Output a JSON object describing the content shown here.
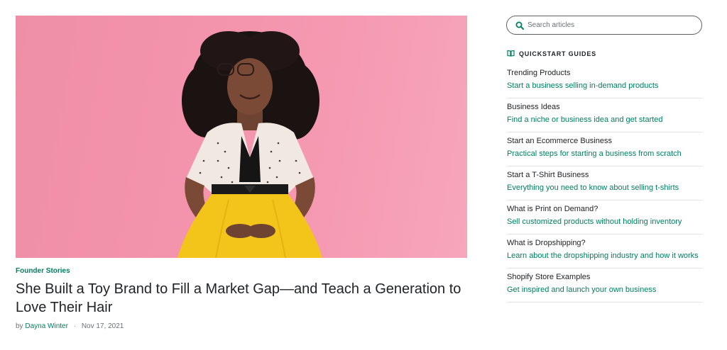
{
  "article": {
    "category": "Founder Stories",
    "title": "She Built a Toy Brand to Fill a Market Gap—and Teach a Generation to Love Their Hair",
    "byline_prefix": "by",
    "author": "Dayna Winter",
    "separator": "·",
    "date": "Nov 17, 2021"
  },
  "search": {
    "placeholder": "Search articles",
    "icon": "search-icon"
  },
  "guides": {
    "heading": "QUICKSTART GUIDES",
    "icon": "book-icon",
    "items": [
      {
        "title": "Trending Products",
        "desc": "Start a business selling in-demand products"
      },
      {
        "title": "Business Ideas",
        "desc": "Find a niche or business idea and get started"
      },
      {
        "title": "Start an Ecommerce Business",
        "desc": "Practical steps for starting a business from scratch"
      },
      {
        "title": "Start a T-Shirt Business",
        "desc": "Everything you need to know about selling t-shirts"
      },
      {
        "title": "What is Print on Demand?",
        "desc": "Sell customized products without holding inventory"
      },
      {
        "title": "What is Dropshipping?",
        "desc": "Learn about the dropshipping industry and how it works"
      },
      {
        "title": "Shopify Store Examples",
        "desc": "Get inspired and launch your own business"
      }
    ]
  },
  "colors": {
    "accent": "#008060",
    "text": "#212326",
    "muted": "#6d7175",
    "hero_bg": "#f493ac"
  }
}
